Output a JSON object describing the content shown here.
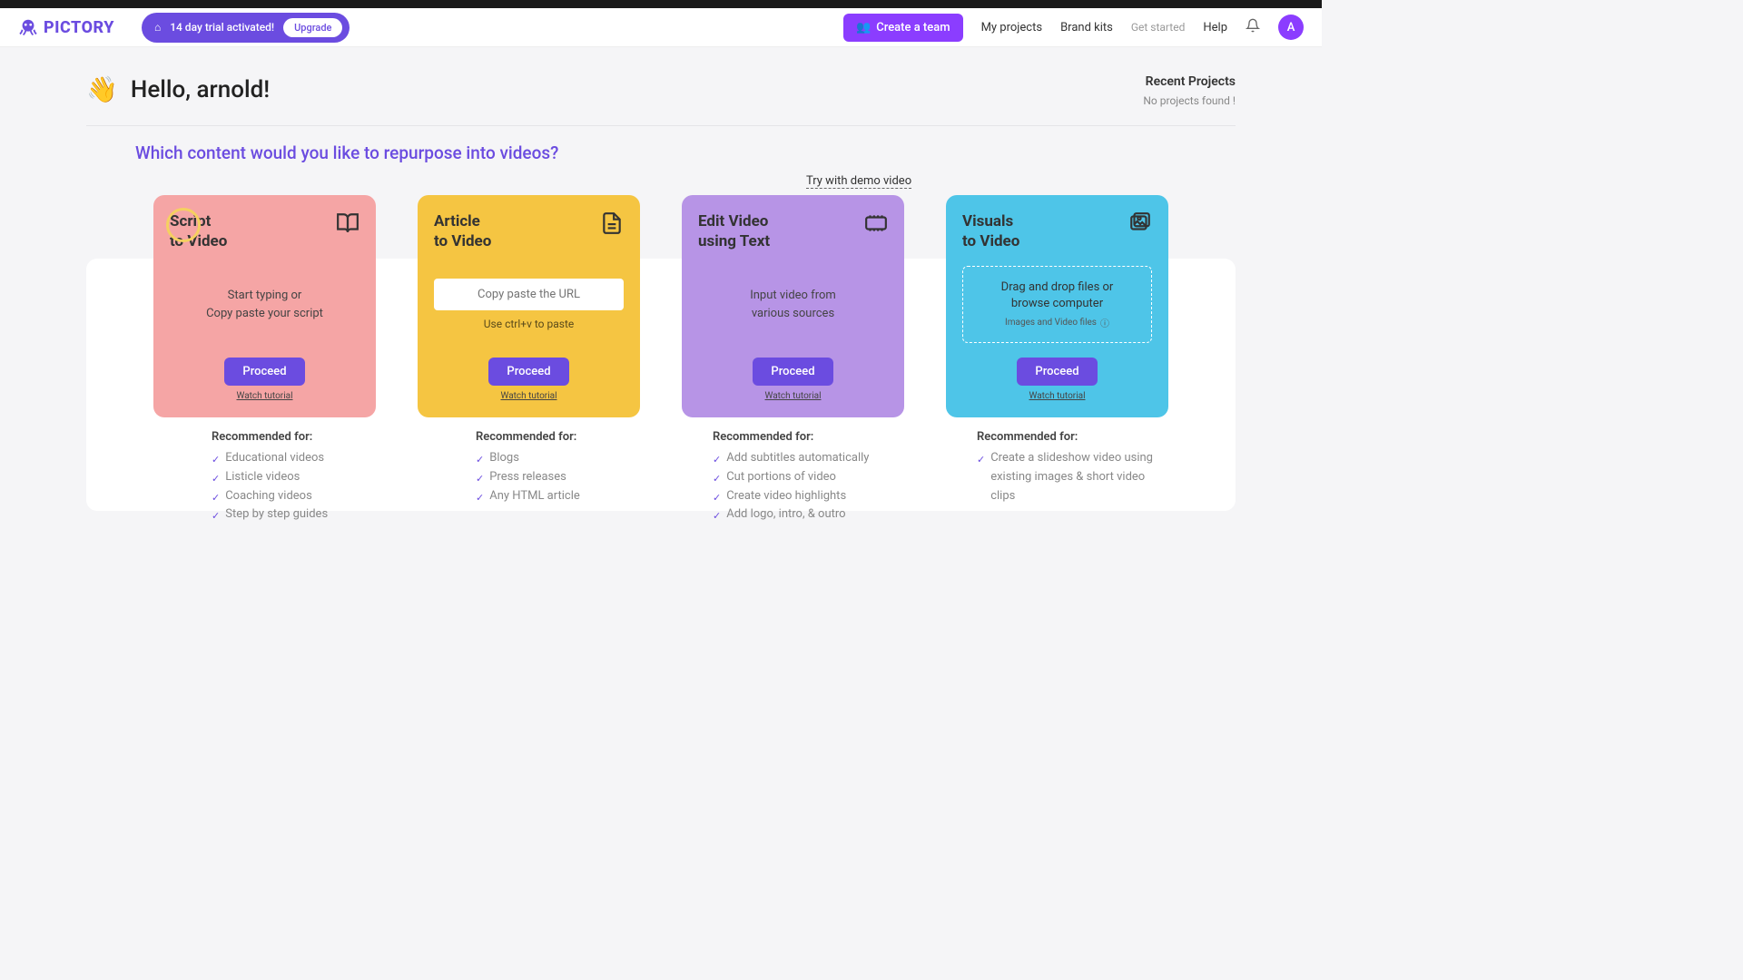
{
  "header": {
    "logo_text": "PICTORY",
    "trial_text": "14 day trial activated!",
    "upgrade_label": "Upgrade",
    "create_team_label": "Create a team",
    "nav": {
      "my_projects": "My projects",
      "brand_kits": "Brand kits",
      "get_started": "Get started",
      "help": "Help"
    },
    "avatar_initial": "A"
  },
  "greeting": {
    "text": "Hello, arnold!",
    "wave": "👋"
  },
  "recent": {
    "title": "Recent Projects",
    "empty": "No projects found !"
  },
  "question": "Which content would you like to repurpose into videos?",
  "demo_link": "Try with demo video",
  "cards": [
    {
      "title_line1": "Script",
      "title_line2": "to Video",
      "body_line1": "Start typing or",
      "body_line2": "Copy paste your script",
      "proceed": "Proceed",
      "tutorial": "Watch tutorial"
    },
    {
      "title_line1": "Article",
      "title_line2": "to Video",
      "url_placeholder": "Copy paste the URL",
      "paste_hint": "Use ctrl+v to paste",
      "proceed": "Proceed",
      "tutorial": "Watch tutorial"
    },
    {
      "title_line1": "Edit Video",
      "title_line2": "using Text",
      "body_line1": "Input video from",
      "body_line2": "various sources",
      "proceed": "Proceed",
      "tutorial": "Watch tutorial"
    },
    {
      "title_line1": "Visuals",
      "title_line2": "to Video",
      "dropzone_line1": "Drag and drop files or",
      "dropzone_line2": "browse computer",
      "dropzone_sub": "Images and Video files",
      "proceed": "Proceed",
      "tutorial": "Watch tutorial"
    }
  ],
  "recommendations": {
    "title": "Recommended for:",
    "cols": [
      [
        "Educational videos",
        "Listicle videos",
        "Coaching videos",
        "Step by step guides"
      ],
      [
        "Blogs",
        "Press releases",
        "Any HTML article"
      ],
      [
        "Add subtitles automatically",
        "Cut portions of video",
        "Create video highlights",
        "Add logo, intro, & outro"
      ],
      [
        "Create a slideshow video using existing images & short video clips"
      ]
    ]
  }
}
